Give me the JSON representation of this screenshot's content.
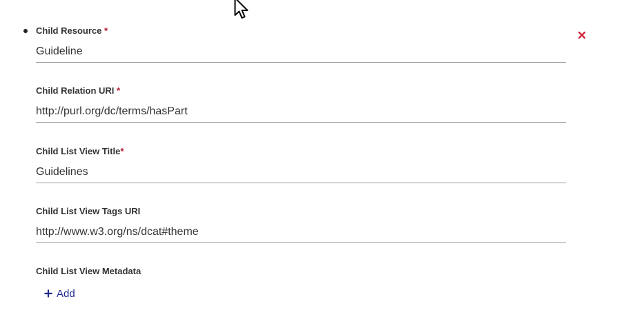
{
  "required_marker": "*",
  "fields": [
    {
      "label": "Child Resource",
      "required": true,
      "value": "Guideline"
    },
    {
      "label": "Child Relation URI",
      "required": true,
      "value": "http://purl.org/dc/terms/hasPart"
    },
    {
      "label": "Child List View Title",
      "required": true,
      "value": "Guidelines"
    },
    {
      "label": "Child List View Tags URI",
      "required": false,
      "value": "http://www.w3.org/ns/dcat#theme"
    }
  ],
  "metadata": {
    "label": "Child List View Metadata",
    "add_label": "Add"
  },
  "icons": {
    "remove": "close-icon",
    "add": "plus-icon",
    "cursor": "mouse-pointer-icon"
  },
  "colors": {
    "required": "#b0172b",
    "remove": "#d0263b",
    "add": "#1f2a8c",
    "label": "#333333",
    "underline": "#9a9a9a"
  }
}
